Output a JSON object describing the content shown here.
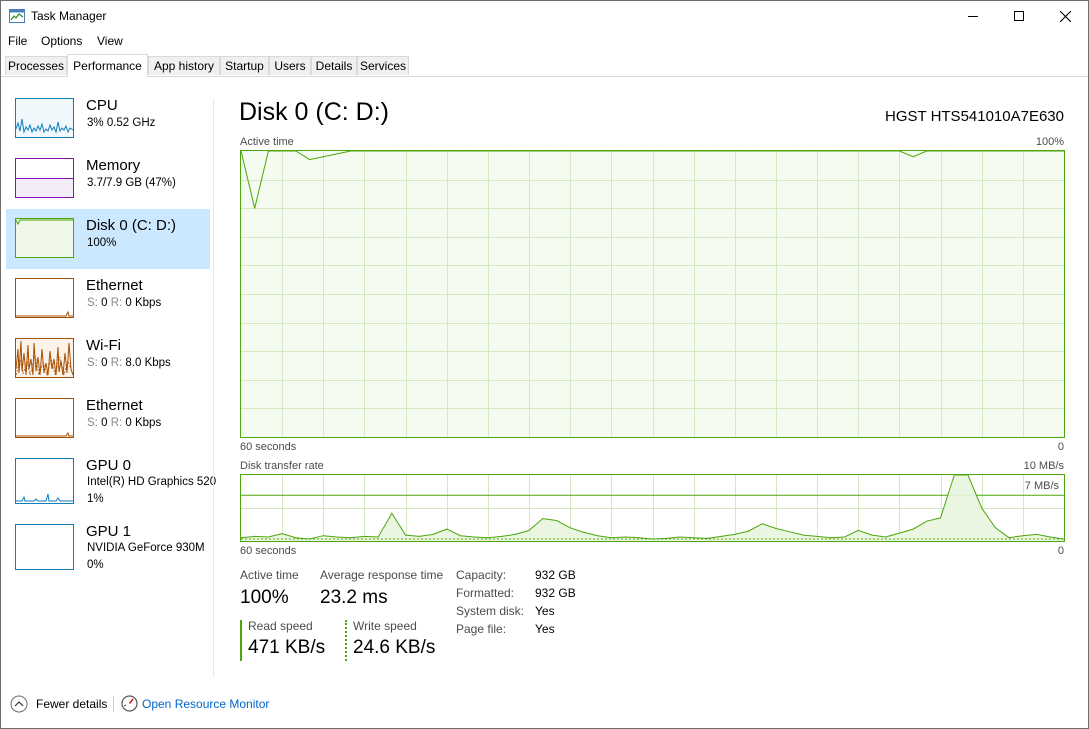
{
  "window": {
    "title": "Task Manager"
  },
  "menu": {
    "file": "File",
    "options": "Options",
    "view": "View"
  },
  "tabs": [
    "Processes",
    "Performance",
    "App history",
    "Startup",
    "Users",
    "Details",
    "Services"
  ],
  "sidebar": {
    "items": [
      {
        "name": "CPU",
        "line1": "3%  0.52 GHz",
        "line2": ""
      },
      {
        "name": "Memory",
        "line1": "3.7/7.9 GB (47%)",
        "line2": ""
      },
      {
        "name": "Disk 0 (C: D:)",
        "line1": "100%",
        "line2": ""
      },
      {
        "name": "Ethernet",
        "s_label": "S:",
        "s_val": "0",
        "r_label": "R:",
        "r_val": "0 Kbps"
      },
      {
        "name": "Wi-Fi",
        "s_label": "S:",
        "s_val": "0",
        "r_label": "R:",
        "r_val": "8.0 Kbps"
      },
      {
        "name": "Ethernet",
        "s_label": "S:",
        "s_val": "0",
        "r_label": "R:",
        "r_val": "0 Kbps"
      },
      {
        "name": "GPU 0",
        "line1": "Intel(R) HD Graphics 520",
        "line2": "1%"
      },
      {
        "name": "GPU 1",
        "line1": "NVIDIA GeForce 930M",
        "line2": "0%"
      }
    ]
  },
  "main": {
    "title": "Disk 0 (C: D:)",
    "model": "HGST HTS541010A7E630",
    "active_graph": {
      "label": "Active time",
      "max_label": "100%",
      "time_label": "60 seconds",
      "min_label": "0"
    },
    "transfer_graph": {
      "label": "Disk transfer rate",
      "max_label": "10 MB/s",
      "line_label": "7 MB/s",
      "time_label": "60 seconds",
      "min_label": "0"
    },
    "stats": {
      "active_time_label": "Active time",
      "active_time_value": "100%",
      "avg_resp_label": "Average response time",
      "avg_resp_value": "23.2 ms",
      "read_label": "Read speed",
      "read_value": "471 KB/s",
      "write_label": "Write speed",
      "write_value": "24.6 KB/s"
    },
    "props": [
      {
        "key": "Capacity:",
        "value": "932 GB"
      },
      {
        "key": "Formatted:",
        "value": "932 GB"
      },
      {
        "key": "System disk:",
        "value": "Yes"
      },
      {
        "key": "Page file:",
        "value": "Yes"
      }
    ]
  },
  "footer": {
    "fewer_details": "Fewer details",
    "open_resource_monitor": "Open Resource Monitor"
  },
  "colors": {
    "disk": "#4da60c",
    "cpu": "#117dbb",
    "memory": "#8b12ae",
    "network": "#a74f01",
    "selected": "#cce8ff"
  },
  "icons": {
    "app": "task-manager-icon",
    "minimize": "minimize-icon",
    "maximize": "maximize-icon",
    "close": "close-icon",
    "chevron": "chevron-up-icon",
    "monitor": "resource-monitor-icon"
  },
  "chart_data": [
    {
      "type": "area",
      "title": "Active time",
      "x": [
        60,
        59,
        58,
        57,
        56,
        55,
        54,
        53,
        52,
        51,
        50,
        49,
        48,
        47,
        46,
        45,
        44,
        43,
        42,
        41,
        40,
        39,
        38,
        37,
        36,
        35,
        34,
        33,
        32,
        31,
        30,
        29,
        28,
        27,
        26,
        25,
        24,
        23,
        22,
        21,
        20,
        19,
        18,
        17,
        16,
        15,
        14,
        13,
        12,
        11,
        10,
        9,
        8,
        7,
        6,
        5,
        4,
        3,
        2,
        1,
        0
      ],
      "values": [
        100,
        80,
        100,
        100,
        100,
        97,
        98,
        99,
        100,
        100,
        100,
        100,
        100,
        100,
        100,
        100,
        100,
        100,
        100,
        100,
        100,
        100,
        100,
        100,
        100,
        100,
        100,
        100,
        100,
        100,
        100,
        100,
        100,
        100,
        100,
        100,
        100,
        100,
        100,
        100,
        100,
        100,
        100,
        100,
        100,
        100,
        100,
        100,
        100,
        98,
        100,
        100,
        100,
        100,
        100,
        100,
        100,
        100,
        100,
        100,
        100
      ],
      "ylim": [
        0,
        100
      ]
    },
    {
      "type": "line",
      "title": "Disk transfer rate",
      "x": [
        60,
        59,
        58,
        57,
        56,
        55,
        54,
        53,
        52,
        51,
        50,
        49,
        48,
        47,
        46,
        45,
        44,
        43,
        42,
        41,
        40,
        39,
        38,
        37,
        36,
        35,
        34,
        33,
        32,
        31,
        30,
        29,
        28,
        27,
        26,
        25,
        24,
        23,
        22,
        21,
        20,
        19,
        18,
        17,
        16,
        15,
        14,
        13,
        12,
        11,
        10,
        9,
        8,
        7,
        6,
        5,
        4,
        3,
        2,
        1,
        0
      ],
      "values": [
        0.5,
        0.7,
        0.6,
        1.1,
        0.5,
        0.3,
        0.8,
        0.6,
        0.5,
        0.7,
        0.6,
        4.2,
        0.9,
        0.7,
        1.0,
        1.8,
        0.8,
        0.6,
        0.5,
        0.7,
        1.0,
        1.6,
        3.4,
        3.1,
        2.0,
        1.3,
        0.8,
        0.5,
        0.6,
        0.5,
        0.3,
        0.4,
        0.6,
        0.5,
        0.4,
        0.7,
        1.0,
        1.5,
        2.6,
        1.9,
        1.4,
        0.9,
        0.7,
        0.5,
        0.6,
        1.6,
        0.9,
        0.6,
        1.2,
        1.8,
        3.0,
        3.5,
        12,
        12,
        5.0,
        2.0,
        0.5,
        0.8,
        1.0,
        0.6,
        0.3
      ],
      "ylim": [
        0,
        10
      ],
      "reference_line": 7
    }
  ]
}
